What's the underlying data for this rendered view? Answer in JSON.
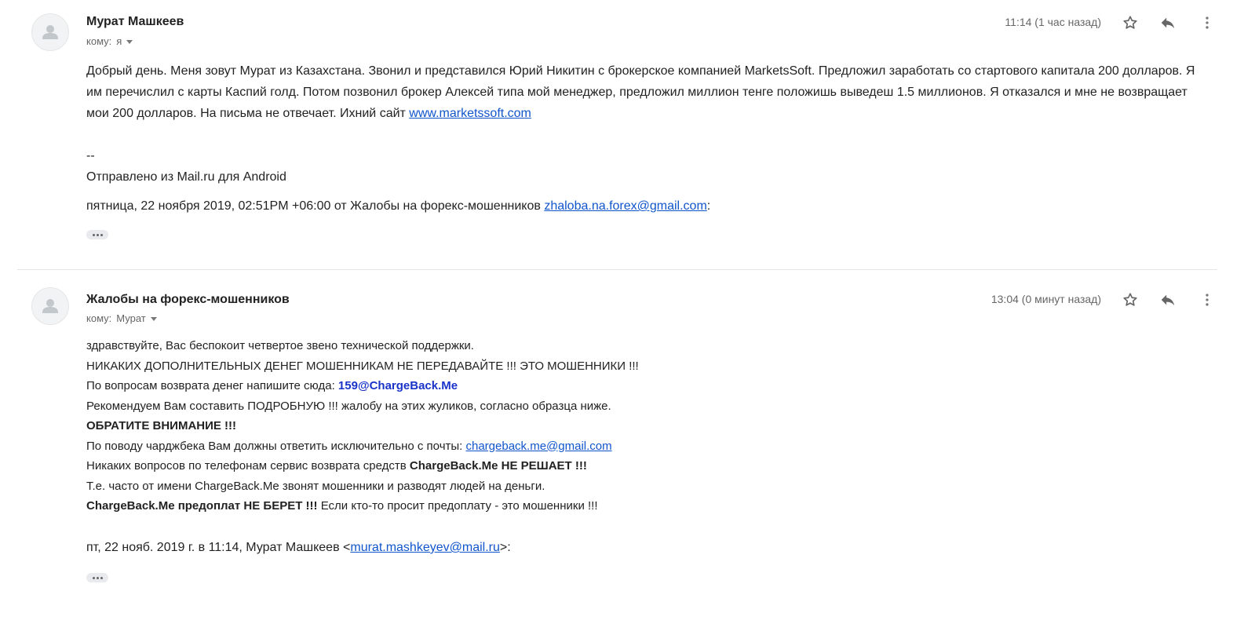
{
  "messages": [
    {
      "sender": "Мурат Машкеев",
      "recipients_prefix": "кому:",
      "recipients": "я",
      "time": "11:14 (1 час назад)",
      "body": {
        "paragraph": "Добрый день. Меня зовут Мурат из Казахстана. Звонил и представился Юрий Никитин с брокерское компанией MarketsSoft. Предложил заработать со стартового капитала 200 долларов. Я им перечислил с карты Каспий голд. Потом позвонил брокер Алексей типа мой менеджер, предложил миллион тенге положишь выведеш 1.5 миллионов. Я отказался и мне не возвращает мои 200 долларов. На письма не отвечает. Ихний сайт ",
        "site_link": "www.marketssoft.com",
        "signature_dash": "--",
        "signature": "Отправлено из Mail.ru для Android"
      },
      "quote_prefix": "пятница, 22 ноября 2019, 02:51PM +06:00 от Жалобы на форекс-мошенников ",
      "quote_email": "zhaloba.na.forex@gmail.com",
      "quote_suffix": ":"
    },
    {
      "sender": "Жалобы на форекс-мошенников",
      "recipients_prefix": "кому:",
      "recipients": "Мурат",
      "time": "13:04 (0 минут назад)",
      "body": {
        "line1": "здравствуйте, Вас беспокоит четвертое звено технической поддержки.",
        "line2": "НИКАКИХ ДОПОЛНИТЕЛЬНЫХ ДЕНЕГ МОШЕННИКАМ НЕ ПЕРЕДАВАЙТЕ !!! ЭТО МОШЕННИКИ !!!",
        "line3_prefix": "По вопросам возврата денег напишите сюда: ",
        "line3_email": "159@ChargeBack.Me",
        "line4": "Рекомендуем Вам составить ПОДРОБНУЮ !!! жалобу на этих жуликов, согласно образца ниже.",
        "line5": "ОБРАТИТЕ ВНИМАНИЕ !!!",
        "line6_prefix": "По поводу чарджбека Вам должны ответить исключительно с почты: ",
        "line6_email": "chargeback.me@gmail.com",
        "line7_prefix": "Никаких вопросов по телефонам сервис возврата средств ",
        "line7_bold": "ChargeBack.Me НЕ РЕШАЕТ !!!",
        "line8": "Т.е. часто от имени ChargeBack.Me звонят мошенники и разводят людей на деньги.",
        "line9_bold": "ChargeBack.Me предоплат НЕ БЕРЕТ !!!",
        "line9_suffix": " Если кто-то просит предоплату - это мошенники !!!"
      },
      "quote_prefix": "пт, 22 нояб. 2019 г. в 11:14, Мурат Машкеев <",
      "quote_email": "murat.mashkeyev@mail.ru",
      "quote_suffix": ">:"
    }
  ],
  "icons": {
    "avatar": "person-icon",
    "star": "star-icon",
    "reply": "reply-icon",
    "more": "more-vert-icon",
    "recipients_toggle": "caret-down-icon",
    "show_trimmed": "ellipsis-icon"
  },
  "colors": {
    "link": "#1155cc",
    "highlight_email": "#1a33c9",
    "meta_text": "#666666"
  }
}
